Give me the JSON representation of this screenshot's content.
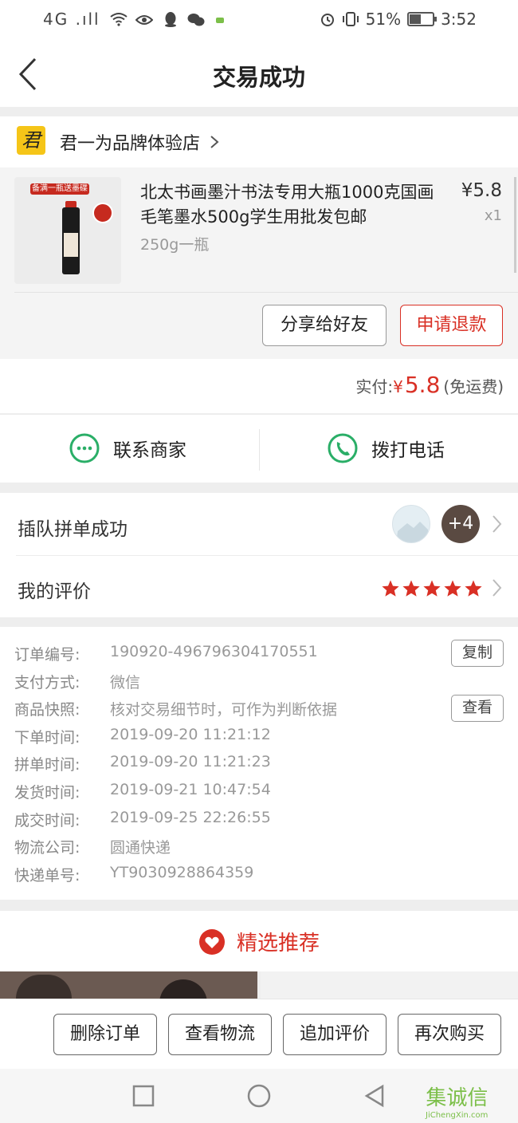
{
  "status_bar": {
    "left": "4G .ıll",
    "battery_pct": "51%",
    "battery_level": 0.51,
    "time": "3:52"
  },
  "nav": {
    "title": "交易成功"
  },
  "shop": {
    "logo_char": "君",
    "name": "君一为品牌体验店"
  },
  "product": {
    "image_banner": "备满一瓶送墨碟",
    "title": "北太书画墨汁书法专用大瓶1000克国画毛笔墨水500g学生用批发包邮",
    "spec": "250g一瓶",
    "price": "¥5.8",
    "qty": "x1",
    "share_btn": "分享给好友",
    "refund_btn": "申请退款"
  },
  "payment": {
    "label": "实付:",
    "currency": "¥",
    "amount": "5.8",
    "note": "(免运费)"
  },
  "contact": {
    "merchant": "联系商家",
    "call": "拨打电话"
  },
  "group": {
    "label": "插队拼单成功",
    "avatar_more": "+4",
    "review_label": "我的评价",
    "rating": 5
  },
  "order_info": [
    {
      "key": "订单编号:",
      "value": "190920-496796304170551",
      "action": "复制"
    },
    {
      "key": "支付方式:",
      "value": "微信"
    },
    {
      "key": "商品快照:",
      "value": "核对交易细节时，可作为判断依据",
      "action": "查看"
    },
    {
      "key": "下单时间:",
      "value": "2019-09-20 11:21:12"
    },
    {
      "key": "拼单时间:",
      "value": "2019-09-20 11:21:23"
    },
    {
      "key": "发货时间:",
      "value": "2019-09-21 10:47:54"
    },
    {
      "key": "成交时间:",
      "value": "2019-09-25 22:26:55"
    },
    {
      "key": "物流公司:",
      "value": "圆通快递"
    },
    {
      "key": "快递单号:",
      "value": "YT9030928864359"
    }
  ],
  "recommend": {
    "title": "精选推荐"
  },
  "actions": [
    "删除订单",
    "查看物流",
    "追加评价",
    "再次购买"
  ],
  "watermark": {
    "big": "集诚信",
    "small": "JiChengXin.com"
  },
  "colors": {
    "accent": "#d93025",
    "wechat_green": "#2aae67",
    "shop_logo": "#f5c518"
  }
}
